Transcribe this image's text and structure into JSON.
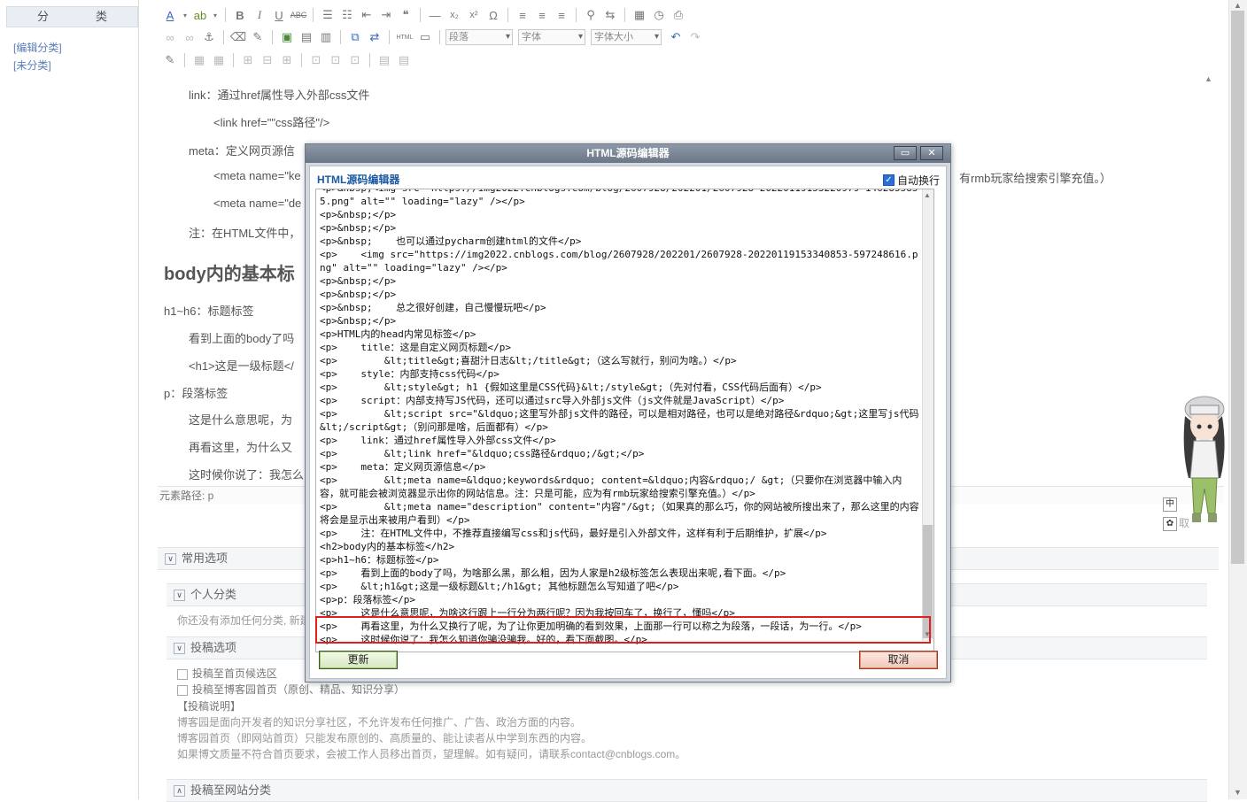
{
  "sidebar": {
    "category_title": "分　类",
    "links": [
      "[编辑分类]",
      "[未分类]"
    ]
  },
  "toolbar": {
    "paragraph_select": "段落",
    "font_select": "字体",
    "font_size_select": "字体大小",
    "html_label": "HTML"
  },
  "editor": {
    "lines": [
      "link：通过href属性导入外部css文件",
      "<link href=\"\"css路径\"/>",
      "meta：定义网页源信",
      "<meta name=\"ke",
      "<meta name=\"de",
      "注：在HTML文件中，",
      "body内的基本标",
      "h1~h6：标题标签",
      "看到上面的body了吗",
      "<h1>这是一级标题</",
      "p：段落标签",
      "这是什么意思呢，为",
      "再看这里，为什么又",
      "这时候你说了：我怎么"
    ],
    "right_overflow": "有rmb玩家给搜索引擎充值。）",
    "path_label": "元素路径: p"
  },
  "panels": {
    "common": "常用选项",
    "personal": "个人分类",
    "personal_note": "你还没有添加任何分类, 新建",
    "post_options": "投稿选项",
    "opt1": "投稿至首页候选区",
    "opt2": "投稿至博客园首页（原创、精品、知识分享）",
    "note_title": "【投稿说明】",
    "note1": "博客园是面向开发者的知识分享社区，不允许发布任何推广、广告、政治方面的内容。",
    "note2": "博客园首页（即网站首页）只能发布原创的、高质量的、能让读者从中学到东西的内容。",
    "note3": "如果博文质量不符合首页要求，会被工作人员移出首页，望理解。如有疑问，请联系contact@cnblogs.com。",
    "site_category": "投稿至网站分类"
  },
  "side_widget": {
    "btn1": "中",
    "btn2": "取"
  },
  "dialog": {
    "title": "HTML源码编辑器",
    "header": "HTML源码编辑器",
    "wrap_label": "自动换行",
    "wrap_checked": true,
    "update_button": "更新",
    "cancel_button": "取消",
    "code": "<p>&nbsp;<img src=\"https://img2022.cnblogs.com/blog/2607928/202201/2607928-20220119153220979-1462855855.png\" alt=\"\" loading=\"lazy\" /></p>\n<p>&nbsp;</p>\n<p>&nbsp;</p>\n<p>&nbsp;    也可以通过pycharm创建html的文件</p>\n<p>    <img src=\"https://img2022.cnblogs.com/blog/2607928/202201/2607928-20220119153340853-597248616.png\" alt=\"\" loading=\"lazy\" /></p>\n<p>&nbsp;</p>\n<p>&nbsp;</p>\n<p>&nbsp;    总之很好创建，自己慢慢玩吧</p>\n<p>&nbsp;</p>\n<p>HTML内的head内常见标签</p>\n<p>    title：这是自定义网页标题</p>\n<p>        &lt;title&gt;喜甜汁日志&lt;/title&gt;（这么写就行，别问为啥。）</p>\n<p>    style：内部支持css代码</p>\n<p>        &lt;style&gt; h1 {假如这里是CSS代码}&lt;/style&gt;（先对付看，CSS代码后面有）</p>\n<p>    script：内部支持写JS代码，还可以通过src导入外部js文件（js文件就是JavaScript）</p>\n<p>        &lt;script src=\"&ldquo;这里写外部js文件的路径，可以是相对路径，也可以是绝对路径&rdquo;&gt;这里写js代码&lt;/script&gt;（别问那是啥，后面都有）</p>\n<p>    link：通过href属性导入外部css文件</p>\n<p>        &lt;link href=\"&ldquo;css路径&rdquo;/&gt;</p>\n<p>    meta：定义网页源信息</p>\n<p>        &lt;meta name=&ldquo;keywords&rdquo; content=&ldquo;内容&rdquo;/ &gt;（只要你在浏览器中输入内容，就可能会被浏览器显示出你的网站信息。注：只是可能，应为有rmb玩家给搜索引擎充值。）</p>\n<p>        &lt;meta name=\"description\" content=\"内容\"/&gt;（如果真的那么巧，你的网站被所搜出来了，那么这里的内容将会是显示出来被用户看到）</p>\n<p>    注：在HTML文件中，不推荐直接编写css和js代码，最好是引入外部文件，这样有利于后期维护，扩展</p>\n<h2>body内的基本标签</h2>\n<p>h1~h6：标题标签</p>\n<p>    看到上面的body了吗，为啥那么黑，那么粗，因为人家是h2级标签怎么表现出来呢,看下面。</p>\n<p>    &lt;h1&gt;这是一级标题&lt;/h1&gt; 其他标题怎么写知道了吧</p>\n<p>p：段落标签</p>\n<p>    这是什么意思呢，为啥这行跟上一行分为两行呢？因为我按回车了，换行了，懂吗</p>\n<p>    再看这里，为什么又换行了呢，为了让你更加明确的看到效果，上面那一行可以称之为段落，一段话，为一行。</p>\n<p>    这时候你说了：我怎么知道你骗没骗我。好的，看下面截图。</p>"
  }
}
